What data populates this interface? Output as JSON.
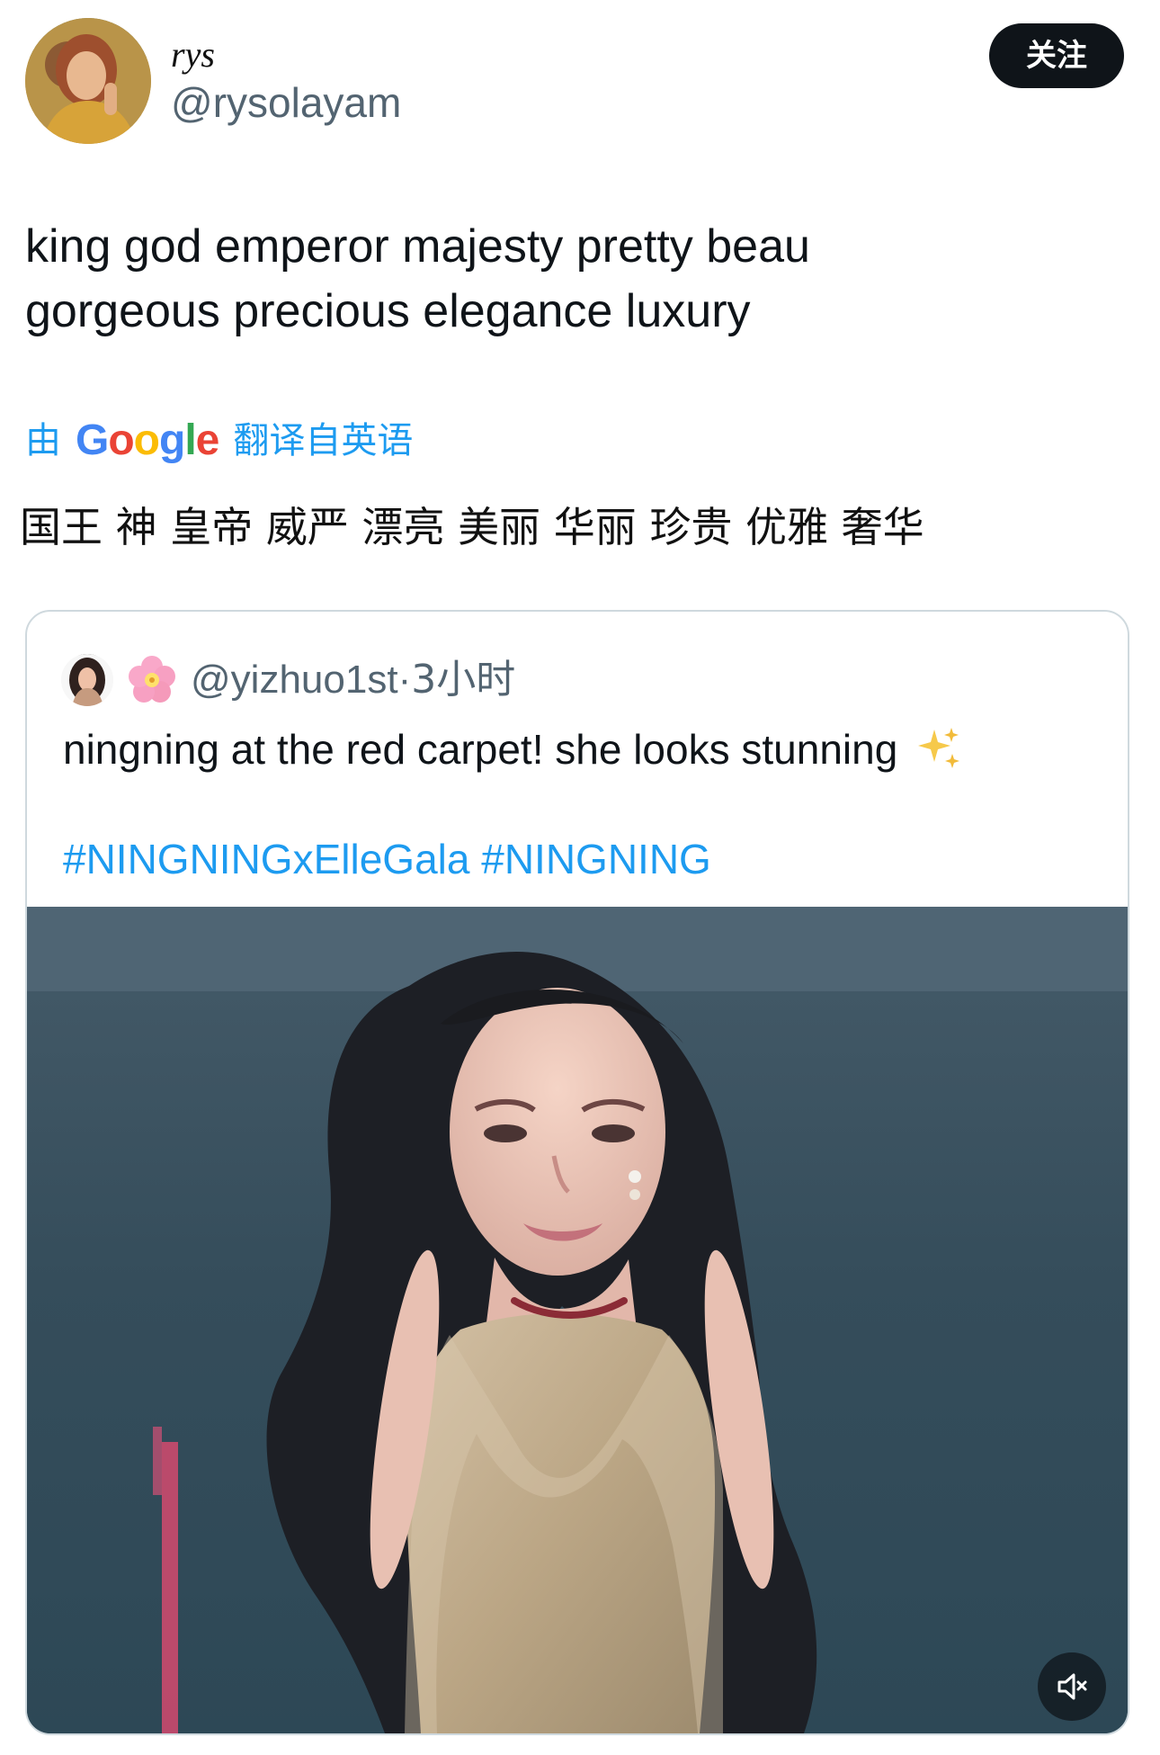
{
  "author": {
    "display_name": "rys",
    "handle": "@rysolayam",
    "follow_label": "关注"
  },
  "tweet": {
    "text": "king god emperor majesty pretty beau\ngorgeous precious elegance luxury"
  },
  "translation": {
    "prefix": "由",
    "provider": [
      "G",
      "o",
      "o",
      "g",
      "l",
      "e"
    ],
    "suffix": "翻译自英语",
    "text": "国王 神 皇帝 威严 漂亮 美丽 华丽 珍贵 优雅 奢华"
  },
  "quote": {
    "handle": "@yizhuo1st",
    "separator": "·",
    "time": "3小时",
    "text": "ningning at the red carpet! she looks stunning",
    "hashtags": [
      "#NINGNINGxElleGala",
      "#NINGNING"
    ]
  },
  "icons": {
    "blossom": "cherry-blossom-icon",
    "sparkles": "sparkles-icon",
    "mute": "muted-speaker-icon"
  },
  "colors": {
    "accent": "#1d9bf0",
    "text": "#0f1419",
    "secondary": "#536471",
    "border": "#cfd9de"
  }
}
